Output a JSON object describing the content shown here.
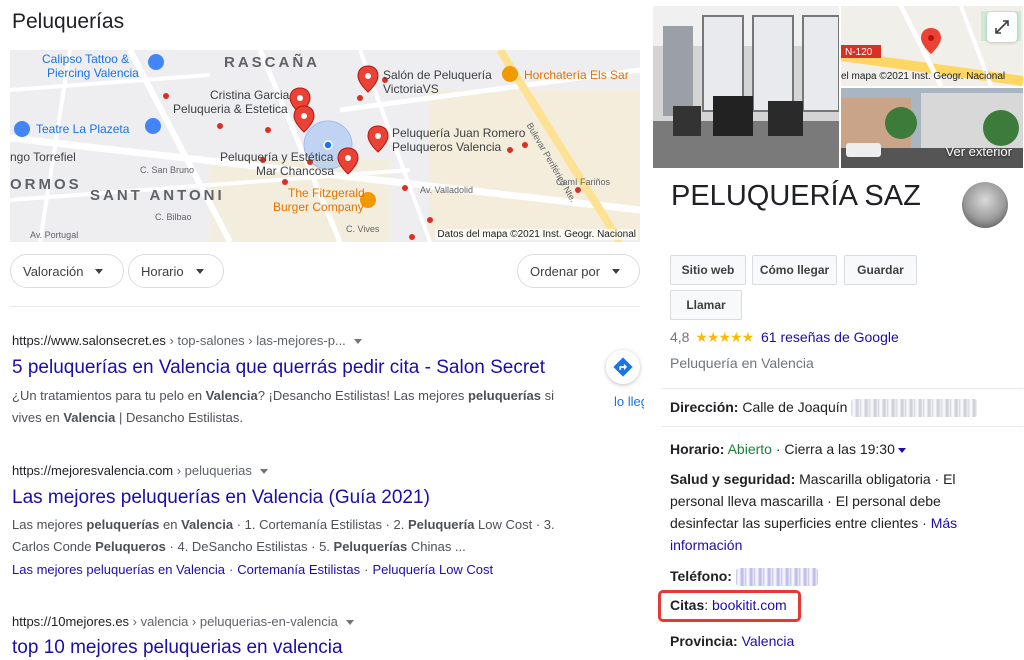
{
  "section": {
    "title": "Peluquerías"
  },
  "map": {
    "credit": "Datos del mapa ©2021 Inst. Geogr. Nacional",
    "labels": {
      "calipso_1": "Calipso Tattoo &",
      "calipso_2": "Piercing Valencia",
      "rascana": "RASCAÑA",
      "cristina_1": "Cristina Garcia",
      "cristina_2": "Peluqueria & Estetica",
      "victoria_1": "Salón de Peluquería",
      "victoria_2": "VictoriaVS",
      "horchateria": "Horchatería Els Sar",
      "teatre": "Teatre La Plazeta",
      "torrefiel": "ngo Torrefiel",
      "juan_romero_1": "Peluquería Juan Romero",
      "juan_romero_2": "Peluqueros Valencia",
      "mar_1": "Peluquería y Estética",
      "mar_2": "Mar Chancosa",
      "ormos": "ORMOS",
      "sant_antoni": "SANT ANTONI",
      "fitzgerald_1": "The Fitzgerald",
      "fitzgerald_2": "Burger Company",
      "street_bruno": "C. San Bruno",
      "street_valladolid": "Av. Valladolid",
      "street_farinos": "Camí Fariños",
      "street_vives": "C. Vives",
      "street_bilbao": "C. Bilbao",
      "street_portugal": "Av. Portugal",
      "street_bulevar": "Bulevar Periférico Nte."
    }
  },
  "filters": {
    "valoracion": "Valoración",
    "horario": "Horario",
    "ordenar": "Ordenar por"
  },
  "results": [
    {
      "url": "https://www.salonsecret.es",
      "crumbs": " › top-salones › las-mejores-p...",
      "title": "5 peluquerías en Valencia que querrás pedir cita - Salon Secret",
      "s1": "¿Un tratamientos para tu pelo en ",
      "s2": "Valencia",
      "s3": "? ¡Desancho Estilistas! Las mejores ",
      "s4": "peluquerías",
      "s5": " si",
      "s6": "vives en ",
      "s7": "Valencia",
      "s8": " | Desancho Estilistas."
    },
    {
      "url": "https://mejoresvalencia.com",
      "crumbs": " › peluquerias",
      "title": "Las mejores peluquerías en Valencia (Guía 2021)",
      "s1": "Las mejores ",
      "s2": "peluquerías",
      "s3": " en ",
      "s4": "Valencia",
      "s5": " · 1. Cortemanía Estilistas · 2. ",
      "s6": "Peluquería",
      "s7": " Low Cost · 3.",
      "s8": "Carlos Conde ",
      "s9": "Peluqueros",
      "s10": " · 4. DeSancho Estilistas · 5. ",
      "s11": "Peluquerías",
      "s12": " Chinas ...",
      "sitelinks": [
        "Las mejores peluquerías en Valencia",
        "Cortemanía Estilistas",
        "Peluquería Low Cost"
      ]
    },
    {
      "url": "https://10mejores.es",
      "crumbs": " › valencia › peluquerias-en-valencia",
      "title": "top 10 mejores peluquerias en valencia"
    }
  ],
  "directions_peek": "lo lleg",
  "knowledge_panel": {
    "photo_map_road": "N-120",
    "photo_map_credit": "el mapa ©2021 Inst. Geogr. Nacional",
    "ver_exterior": "Ver exterior",
    "title": "PELUQUERÍA SAZ",
    "buttons": {
      "sitio_web": "Sitio web",
      "como_llegar": "Cómo llegar",
      "guardar": "Guardar",
      "llamar": "Llamar"
    },
    "rating": "4,8",
    "stars": "★★★★★",
    "reviews": "61 reseñas de Google",
    "category": "Peluquería en Valencia",
    "direccion_label": "Dirección:",
    "direccion_value": "Calle de Joaquín",
    "horario_label": "Horario:",
    "horario_status": "Abierto",
    "horario_rest": " · Cierra a las 19:30",
    "salud_label": "Salud y seguridad:",
    "salud_1": " Mascarilla obligatoria · El",
    "salud_2": "personal lleva mascarilla · El personal debe",
    "salud_3": "desinfectar las superficies entre clientes · ",
    "salud_link_1": "Más",
    "salud_link_2": "información",
    "telefono_label": "Teléfono:",
    "citas_label": "Citas",
    "citas_colon": ": ",
    "citas_link": "bookitit.com",
    "provincia_label": "Provincia:",
    "provincia_value": "Valencia",
    "highlight_color": "#e53935"
  }
}
